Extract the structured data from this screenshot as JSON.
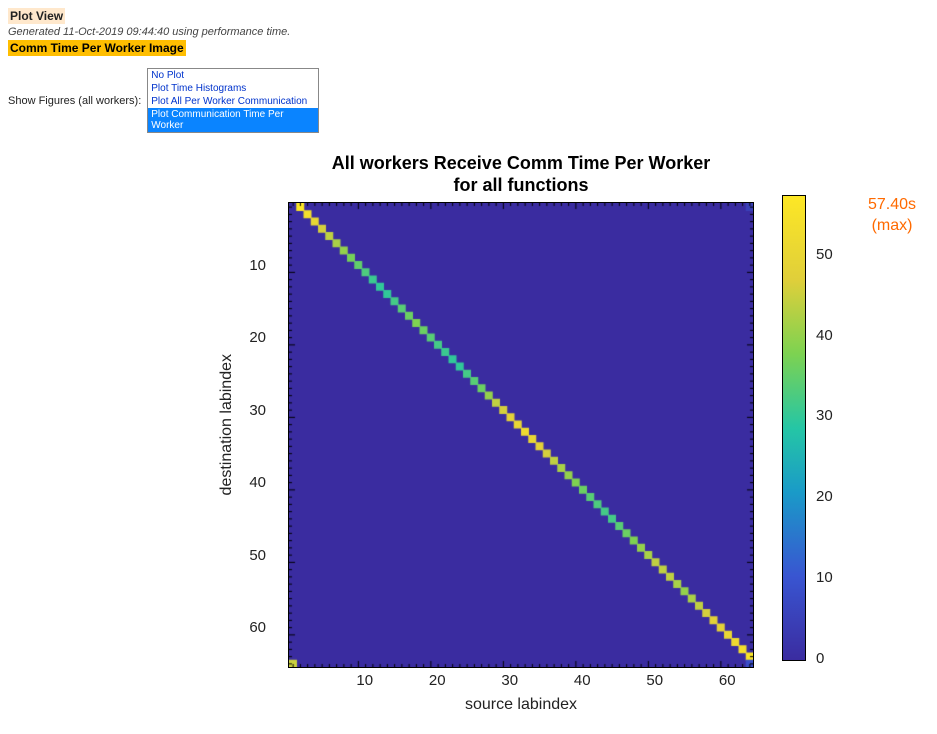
{
  "header": {
    "plot_view": "Plot View",
    "generated": "Generated 11-Oct-2019 09:44:40 using performance time.",
    "subtitle": "Comm Time Per Worker Image"
  },
  "figselect": {
    "label": "Show Figures (all workers):",
    "options": [
      {
        "label": "No Plot",
        "selected": false
      },
      {
        "label": "Plot Time Histograms",
        "selected": false
      },
      {
        "label": "Plot All Per Worker Communication",
        "selected": false
      },
      {
        "label": "Plot Communication Time Per Worker",
        "selected": true
      }
    ]
  },
  "chart_data": {
    "type": "heatmap",
    "title_line1": "All workers Receive Comm Time Per Worker",
    "title_line2": "for all functions",
    "xlabel": "source labindex",
    "ylabel": "destination labindex",
    "n": 64,
    "xticks": [
      10,
      20,
      30,
      40,
      50,
      60
    ],
    "yticks": [
      10,
      20,
      30,
      40,
      50,
      60
    ],
    "colorbar_ticks": [
      0,
      10,
      20,
      30,
      40,
      50
    ],
    "color_range": [
      0,
      57.4
    ],
    "max_label_line1": "57.40s",
    "max_label_line2": "(max)",
    "note": "Matrix is near-zero off the cyclic diagonal. Cell (dest=i, source=(i mod 64)+1) carries the bulk of comm time; approximate values below (seconds).",
    "cells": [
      {
        "dest": 1,
        "source": 2,
        "value": 57
      },
      {
        "dest": 2,
        "source": 3,
        "value": 54
      },
      {
        "dest": 3,
        "source": 4,
        "value": 50
      },
      {
        "dest": 4,
        "source": 5,
        "value": 46
      },
      {
        "dest": 5,
        "source": 6,
        "value": 44
      },
      {
        "dest": 6,
        "source": 7,
        "value": 42
      },
      {
        "dest": 7,
        "source": 8,
        "value": 40
      },
      {
        "dest": 8,
        "source": 9,
        "value": 37
      },
      {
        "dest": 9,
        "source": 10,
        "value": 35
      },
      {
        "dest": 10,
        "source": 11,
        "value": 33
      },
      {
        "dest": 11,
        "source": 12,
        "value": 31
      },
      {
        "dest": 12,
        "source": 13,
        "value": 30
      },
      {
        "dest": 13,
        "source": 14,
        "value": 30
      },
      {
        "dest": 14,
        "source": 15,
        "value": 32
      },
      {
        "dest": 15,
        "source": 16,
        "value": 34
      },
      {
        "dest": 16,
        "source": 17,
        "value": 36
      },
      {
        "dest": 17,
        "source": 18,
        "value": 38
      },
      {
        "dest": 18,
        "source": 19,
        "value": 36
      },
      {
        "dest": 19,
        "source": 20,
        "value": 34
      },
      {
        "dest": 20,
        "source": 21,
        "value": 32
      },
      {
        "dest": 21,
        "source": 22,
        "value": 31
      },
      {
        "dest": 22,
        "source": 23,
        "value": 30
      },
      {
        "dest": 23,
        "source": 24,
        "value": 30
      },
      {
        "dest": 24,
        "source": 25,
        "value": 32
      },
      {
        "dest": 25,
        "source": 26,
        "value": 34
      },
      {
        "dest": 26,
        "source": 27,
        "value": 36
      },
      {
        "dest": 27,
        "source": 28,
        "value": 40
      },
      {
        "dest": 28,
        "source": 29,
        "value": 44
      },
      {
        "dest": 29,
        "source": 30,
        "value": 46
      },
      {
        "dest": 30,
        "source": 31,
        "value": 48
      },
      {
        "dest": 31,
        "source": 32,
        "value": 50
      },
      {
        "dest": 32,
        "source": 33,
        "value": 52
      },
      {
        "dest": 33,
        "source": 34,
        "value": 50
      },
      {
        "dest": 34,
        "source": 35,
        "value": 48
      },
      {
        "dest": 35,
        "source": 36,
        "value": 46
      },
      {
        "dest": 36,
        "source": 37,
        "value": 44
      },
      {
        "dest": 37,
        "source": 38,
        "value": 42
      },
      {
        "dest": 38,
        "source": 39,
        "value": 40
      },
      {
        "dest": 39,
        "source": 40,
        "value": 38
      },
      {
        "dest": 40,
        "source": 41,
        "value": 36
      },
      {
        "dest": 41,
        "source": 42,
        "value": 34
      },
      {
        "dest": 42,
        "source": 43,
        "value": 33
      },
      {
        "dest": 43,
        "source": 44,
        "value": 32
      },
      {
        "dest": 44,
        "source": 45,
        "value": 32
      },
      {
        "dest": 45,
        "source": 46,
        "value": 34
      },
      {
        "dest": 46,
        "source": 47,
        "value": 36
      },
      {
        "dest": 47,
        "source": 48,
        "value": 38
      },
      {
        "dest": 48,
        "source": 49,
        "value": 40
      },
      {
        "dest": 49,
        "source": 50,
        "value": 42
      },
      {
        "dest": 50,
        "source": 51,
        "value": 44
      },
      {
        "dest": 51,
        "source": 52,
        "value": 44
      },
      {
        "dest": 52,
        "source": 53,
        "value": 44
      },
      {
        "dest": 53,
        "source": 54,
        "value": 42
      },
      {
        "dest": 54,
        "source": 55,
        "value": 40
      },
      {
        "dest": 55,
        "source": 56,
        "value": 42
      },
      {
        "dest": 56,
        "source": 57,
        "value": 44
      },
      {
        "dest": 57,
        "source": 58,
        "value": 46
      },
      {
        "dest": 58,
        "source": 59,
        "value": 48
      },
      {
        "dest": 59,
        "source": 60,
        "value": 48
      },
      {
        "dest": 60,
        "source": 61,
        "value": 50
      },
      {
        "dest": 61,
        "source": 62,
        "value": 52
      },
      {
        "dest": 62,
        "source": 63,
        "value": 54
      },
      {
        "dest": 63,
        "source": 64,
        "value": 56
      },
      {
        "dest": 64,
        "source": 1,
        "value": 45
      },
      {
        "dest": 1,
        "source": 64,
        "value": 5
      },
      {
        "dest": 64,
        "source": 64,
        "value": 8
      }
    ]
  }
}
